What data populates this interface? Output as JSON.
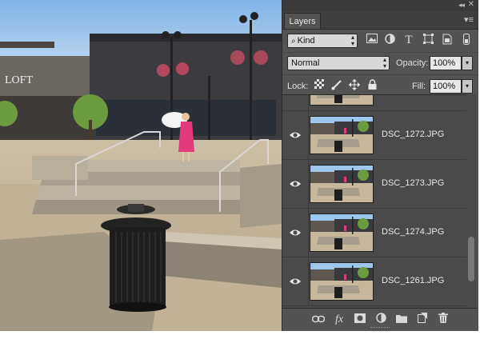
{
  "panel": {
    "tab_label": "Layers",
    "collapse_glyph": "◂◂",
    "close_glyph": "✕",
    "menu_glyph": "▾≡",
    "filter": {
      "label": "Kind",
      "icon": "search-icon"
    },
    "filter_icons": [
      "image-filter-icon",
      "adjustment-filter-icon",
      "type-filter-icon",
      "shape-filter-icon",
      "smart-object-filter-icon",
      "toggle-filter-icon"
    ],
    "blend_mode": "Normal",
    "opacity_label": "Opacity:",
    "opacity_value": "100%",
    "lock_label": "Lock:",
    "fill_label": "Fill:",
    "fill_value": "100%"
  },
  "layers": [
    {
      "name": ""
    },
    {
      "name": "DSC_1272.JPG"
    },
    {
      "name": "DSC_1273.JPG"
    },
    {
      "name": "DSC_1274.JPG"
    },
    {
      "name": "DSC_1261.JPG"
    }
  ],
  "photo": {
    "storefront_sign": "LOFT"
  },
  "colors": {
    "panel_bg": "#535353",
    "panel_dark": "#3a3a3a",
    "sky": "#9ec7ee",
    "dress": "#e23a7a"
  }
}
